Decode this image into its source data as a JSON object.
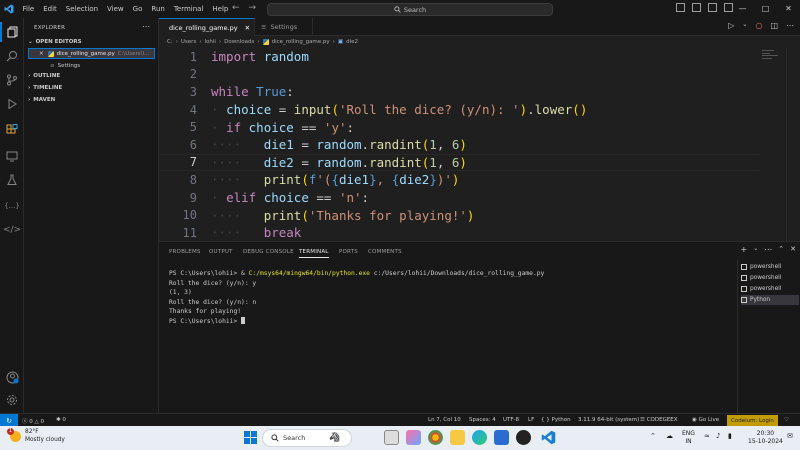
{
  "menu": [
    "File",
    "Edit",
    "Selection",
    "View",
    "Go",
    "Run",
    "Terminal",
    "Help"
  ],
  "search": {
    "label": "Search"
  },
  "sidebar": {
    "title": "EXPLORER",
    "sections": {
      "open_editors": "OPEN EDITORS",
      "outline": "OUTLINE",
      "timeline": "TIMELINE",
      "maven": "MAVEN"
    },
    "open_files": [
      {
        "name": "dice_rolling_game.py",
        "path": "C:\\Users\\l..."
      },
      {
        "name": "Settings",
        "path": ""
      }
    ]
  },
  "tabs": [
    {
      "label": "dice_rolling_game.py",
      "active": true
    },
    {
      "label": "Settings",
      "active": false
    }
  ],
  "breadcrumbs": [
    "C:",
    "Users",
    "lohii",
    "Downloads",
    "dice_rolling_game.py",
    "die2"
  ],
  "code_lines": [
    "import random",
    "",
    "while True:",
    "    choice = input('Roll the dice? (y/n): ').lower()",
    "    if choice == 'y':",
    "        die1 = random.randint(1, 6)",
    "        die2 = random.randint(1, 6)",
    "        print(f'({die1}, {die2})')",
    "    elif choice == 'n':",
    "        print('Thanks for playing!')",
    "        break"
  ],
  "line_numbers": [
    "1",
    "2",
    "3",
    "4",
    "5",
    "6",
    "7",
    "8",
    "9",
    "10",
    "11"
  ],
  "panel_tabs": [
    "PROBLEMS",
    "OUTPUT",
    "DEBUG CONSOLE",
    "TERMINAL",
    "PORTS",
    "COMMENTS"
  ],
  "terminal": {
    "line1_prompt": "PS C:\\Users\\lohii> & ",
    "line1_exe": "C:/msys64/mingw64/bin/python.exe",
    "line1_arg": " c:/Users/lohii/Downloads/dice_rolling_game.py",
    "lines": [
      "Roll the dice? (y/n): y",
      "(1, 3)",
      "Roll the dice? (y/n): n",
      "Thanks for playing!",
      "PS C:\\Users\\lohii> "
    ]
  },
  "terminal_list": [
    "powershell",
    "powershell",
    "powershell",
    "Python"
  ],
  "status": {
    "errors": "0",
    "warnings": "0",
    "ports": "0",
    "position": "Ln 7, Col 10",
    "spaces": "Spaces: 4",
    "encoding": "UTF-8",
    "eol": "LF",
    "language": "Python",
    "interpreter": "3.11.9 64-bit (system)",
    "codegeex": "CODEGEEX",
    "golive": "Go Live",
    "codeium": "Codeium: Login"
  },
  "taskbar": {
    "weather_temp": "82°F",
    "weather_desc": "Mostly cloudy",
    "weather_badge": "1",
    "search": "Search",
    "lang1": "ENG",
    "lang2": "IN",
    "time": "20:30",
    "date": "15-10-2024"
  },
  "colors": {
    "accent": "#0078d4",
    "keyword": "#c586c0",
    "string": "#ce9178",
    "function": "#dcdcaa",
    "variable": "#9cdcfe",
    "codeium_bg": "#c19c00"
  }
}
